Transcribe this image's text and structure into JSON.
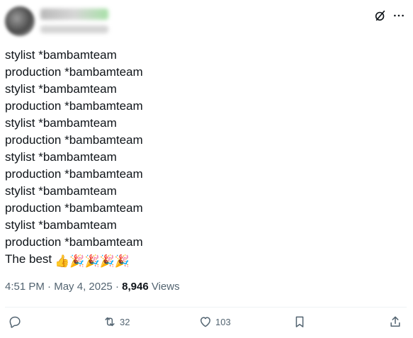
{
  "tweet": {
    "lines": [
      "stylist *bambamteam",
      "production *bambamteam",
      "stylist *bambamteam",
      "production *bambamteam",
      "stylist *bambamteam",
      "production *bambamteam",
      "stylist *bambamteam",
      "production *bambamteam",
      "stylist *bambamteam",
      "production *bambamteam",
      "stylist *bambamteam",
      "production *bambamteam"
    ],
    "last_line_text": "The best",
    "last_line_emojis": [
      "👍",
      "🎉",
      "🎉",
      "🎉",
      "🎉"
    ],
    "time": "4:51 PM",
    "date": "May 4, 2025",
    "views_count": "8,946",
    "views_label": "Views",
    "separator": "·"
  },
  "actions": {
    "reply_count": "",
    "retweet_count": "32",
    "like_count": "103"
  },
  "icons": {
    "reply": "reply-icon",
    "retweet": "retweet-icon",
    "like": "heart-icon",
    "bookmark": "bookmark-icon",
    "share": "share-icon",
    "grok": "grok-icon",
    "more": "more-icon"
  }
}
